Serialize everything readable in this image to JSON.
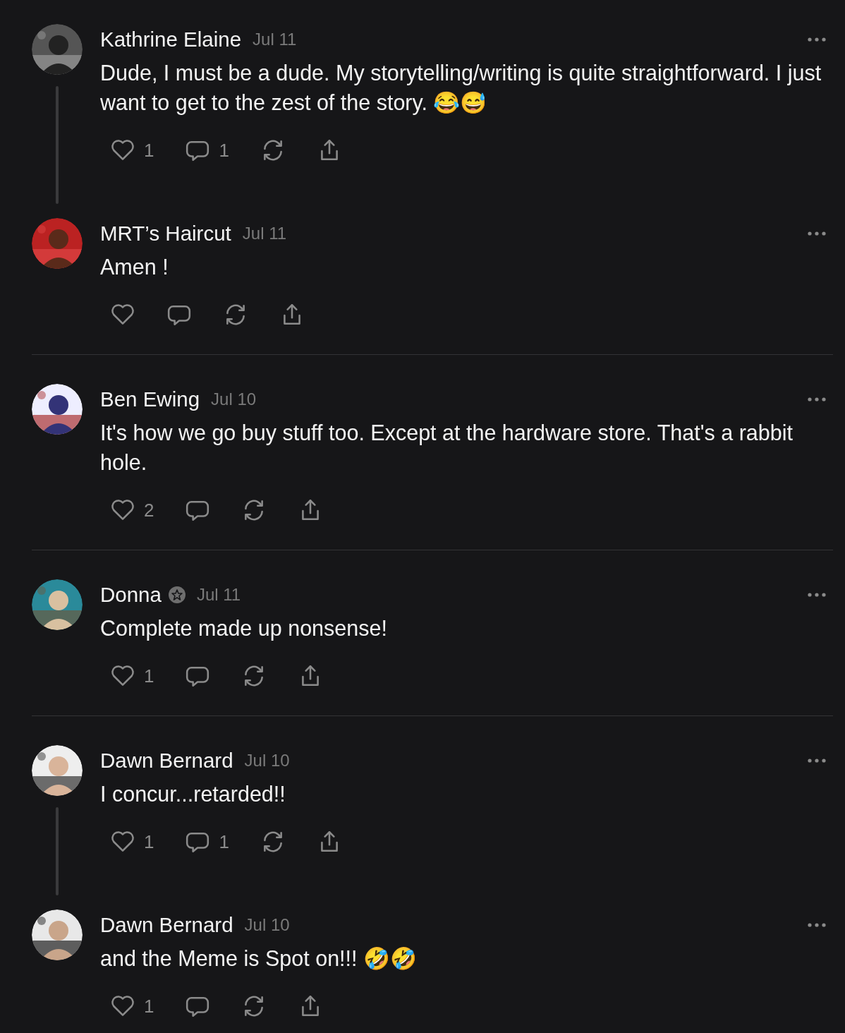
{
  "threads": [
    {
      "posts": [
        {
          "author": "Kathrine Elaine",
          "verified": false,
          "date": "Jul 11",
          "text": "Dude, I must be a dude. My storytelling/writing is quite straightforward. I just want to get to the zest of the story. 😂😅",
          "likes": "1",
          "replies": "1"
        },
        {
          "author": "MRT’s Haircut",
          "verified": false,
          "date": "Jul 11",
          "text": "Amen !"
        }
      ]
    },
    {
      "posts": [
        {
          "author": "Ben Ewing",
          "verified": false,
          "date": "Jul 10",
          "text": "It's how we go buy stuff too. Except at the hardware store. That's a rabbit hole.",
          "likes": "2"
        }
      ]
    },
    {
      "posts": [
        {
          "author": "Donna",
          "verified": true,
          "date": "Jul 11",
          "text": "Complete made up nonsense!",
          "likes": "1"
        }
      ]
    },
    {
      "posts": [
        {
          "author": "Dawn Bernard",
          "verified": false,
          "date": "Jul 10",
          "text": "I concur...retarded!!",
          "likes": "1",
          "replies": "1"
        },
        {
          "author": "Dawn Bernard",
          "verified": false,
          "date": "Jul 10",
          "text": "and the Meme is Spot on!!! 🤣🤣",
          "likes": "1"
        }
      ]
    }
  ]
}
